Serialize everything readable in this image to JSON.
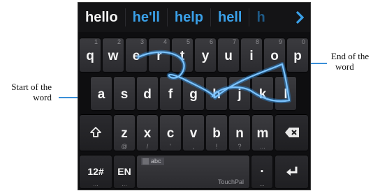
{
  "suggestions": {
    "primary": "hello",
    "alternatives": [
      "he'll",
      "help",
      "hell",
      "h"
    ]
  },
  "rows": {
    "row1": [
      {
        "label": "q",
        "hint": "1"
      },
      {
        "label": "w",
        "hint": "2"
      },
      {
        "label": "e",
        "hint": "3"
      },
      {
        "label": "r",
        "hint": "4"
      },
      {
        "label": "t",
        "hint": "5"
      },
      {
        "label": "y",
        "hint": "6"
      },
      {
        "label": "u",
        "hint": "7"
      },
      {
        "label": "i",
        "hint": "8"
      },
      {
        "label": "o",
        "hint": "9"
      },
      {
        "label": "p",
        "hint": "0"
      }
    ],
    "row2": [
      "a",
      "s",
      "d",
      "f",
      "g",
      "h",
      "j",
      "k",
      "l"
    ],
    "row3": [
      {
        "label": "z",
        "sub": "@"
      },
      {
        "label": "x",
        "sub": "/"
      },
      {
        "label": "c",
        "sub": "'"
      },
      {
        "label": "v",
        "sub": ","
      },
      {
        "label": "b",
        "sub": "!"
      },
      {
        "label": "n",
        "sub": "?"
      },
      {
        "label": "m",
        "sub": "..."
      }
    ],
    "row4": {
      "numbers_label": "12#",
      "numbers_sub": "...",
      "lang_label": "EN",
      "lang_sub": "...",
      "space_badge": "abc",
      "space_brand": "TouchPal",
      "period_label": ".",
      "period_sub": "..."
    }
  },
  "callouts": {
    "start_line1": "Start of the",
    "start_line2": "word",
    "end_line1": "End of the",
    "end_line2": "word"
  },
  "colors": {
    "trace": "#2f8fe0",
    "suggestion_alt": "#3aa0e8",
    "callout_line": "#3a8fd8"
  }
}
